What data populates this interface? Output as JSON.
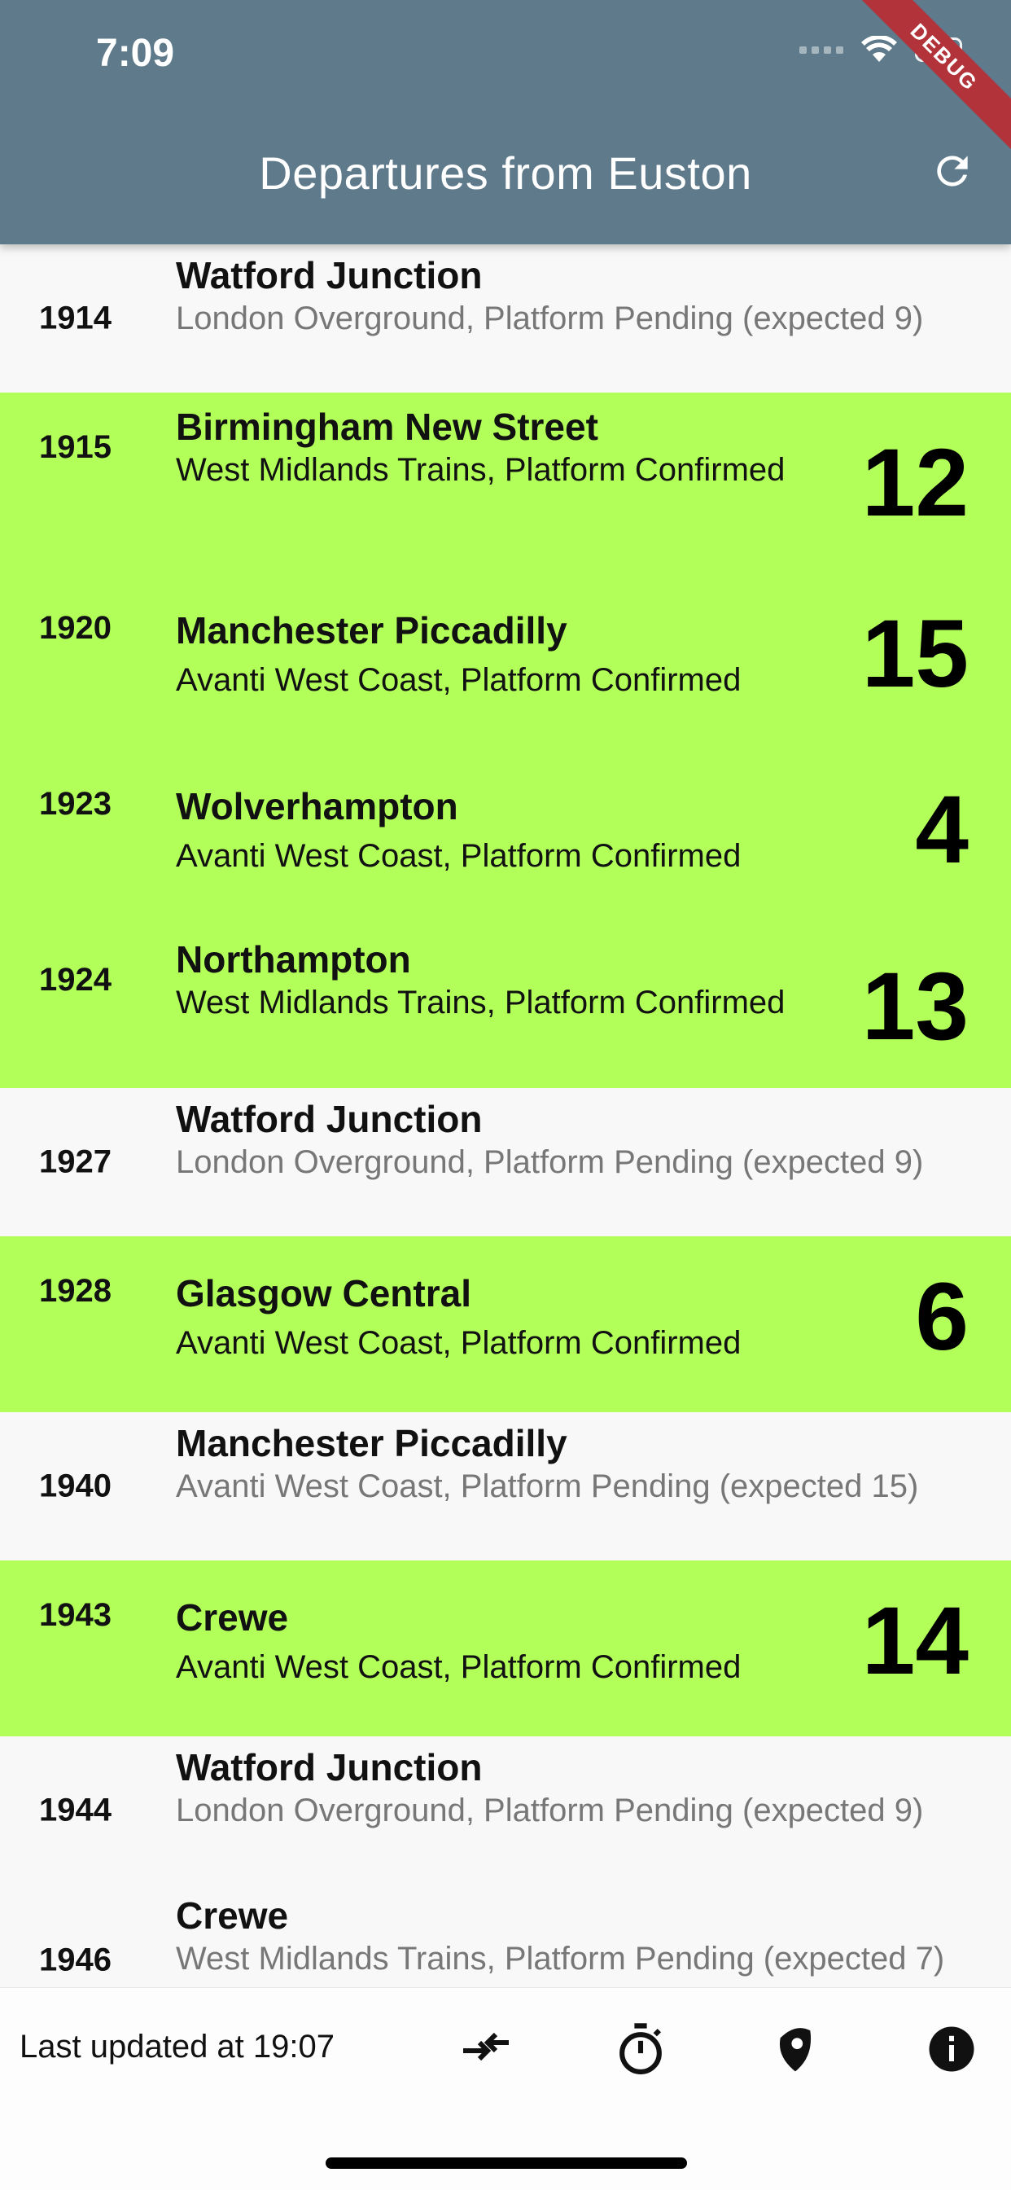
{
  "status_bar": {
    "time": "7:09"
  },
  "header": {
    "title": "Departures from Euston",
    "debug_label": "DEBUG"
  },
  "departures": [
    {
      "time": "1914",
      "destination": "Watford Junction",
      "detail": "London Overground, Platform Pending (expected 9)",
      "platform": "",
      "confirmed": false
    },
    {
      "time": "1915",
      "destination": "Birmingham New Street",
      "detail": "West Midlands Trains, Platform Confirmed",
      "platform": "12",
      "confirmed": true
    },
    {
      "time": "1920",
      "destination": "Manchester Piccadilly",
      "detail": "Avanti West Coast, Platform Confirmed",
      "platform": "15",
      "confirmed": true
    },
    {
      "time": "1923",
      "destination": "Wolverhampton",
      "detail": "Avanti West Coast, Platform Confirmed",
      "platform": "4",
      "confirmed": true
    },
    {
      "time": "1924",
      "destination": "Northampton",
      "detail": "West Midlands Trains, Platform Confirmed",
      "platform": "13",
      "confirmed": true
    },
    {
      "time": "1927",
      "destination": "Watford Junction",
      "detail": "London Overground, Platform Pending (expected 9)",
      "platform": "",
      "confirmed": false
    },
    {
      "time": "1928",
      "destination": "Glasgow Central",
      "detail": "Avanti West Coast, Platform Confirmed",
      "platform": "6",
      "confirmed": true
    },
    {
      "time": "1940",
      "destination": "Manchester Piccadilly",
      "detail": "Avanti West Coast, Platform Pending (expected 15)",
      "platform": "",
      "confirmed": false
    },
    {
      "time": "1943",
      "destination": "Crewe",
      "detail": "Avanti West Coast, Platform Confirmed",
      "platform": "14",
      "confirmed": true
    },
    {
      "time": "1944",
      "destination": "Watford Junction",
      "detail": "London Overground, Platform Pending (expected 9)",
      "platform": "",
      "confirmed": false
    },
    {
      "time": "1946",
      "destination": "Crewe",
      "detail": "West Midlands Trains, Platform Pending (expected 7)",
      "platform": "",
      "confirmed": false
    }
  ],
  "footer": {
    "last_updated": "Last updated at 19:07",
    "icons": [
      "swap-arrows-icon",
      "stopwatch-icon",
      "location-pin-icon",
      "info-icon"
    ]
  },
  "colors": {
    "appbar": "#5e7a8b",
    "confirmed_row": "#b2ff59",
    "pending_row": "#f8f8f8",
    "debug_banner": "#b3333a"
  }
}
